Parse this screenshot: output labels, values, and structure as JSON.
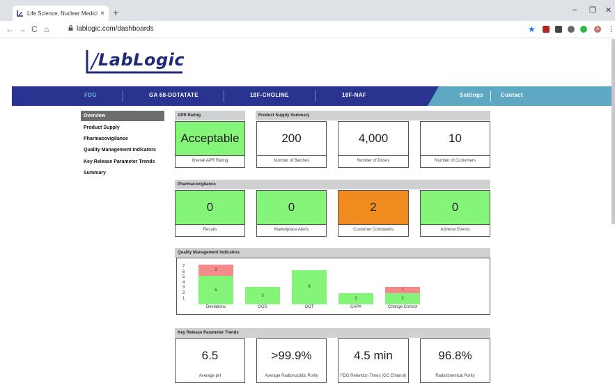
{
  "browser": {
    "tab_title": "Life Science, Nuclear Medicine &",
    "tab_close": "×",
    "new_tab": "+",
    "url": "lablogic.com/dashboards",
    "min": "–",
    "restore": "❐",
    "close": "✕",
    "back": "←",
    "forward": "→",
    "reload": "C",
    "home": "⌂",
    "profile_initial": "A",
    "menu": "⋮"
  },
  "logo": {
    "text": "LabLogic"
  },
  "nav": {
    "items": [
      "FDG",
      "GA 68-DOTATATE",
      "18F-CHOLINE",
      "18F-NAF"
    ],
    "settings": "Settings",
    "contact": "Contact",
    "colors": {
      "main": "#28348f",
      "right": "#5fa8c4"
    }
  },
  "sidebar": {
    "items": [
      "Overview",
      "Product Supply",
      "Pharmacovigilance",
      "Quality Management Indicators",
      "Key Release Parameter Trends",
      "Summary"
    ],
    "active": "Overview"
  },
  "apr": {
    "header": "APR Rating",
    "value": "Acceptable",
    "label": "Overall APR Rating"
  },
  "supply": {
    "header": "Product Supply Summary",
    "cards": [
      {
        "value": "200",
        "label": "Number of Batches"
      },
      {
        "value": "4,000",
        "label": "Number of Doses"
      },
      {
        "value": "10",
        "label": "Number of Customers"
      }
    ]
  },
  "pharma": {
    "header": "Pharmacovigilance",
    "cards": [
      {
        "value": "0",
        "label": "Recalls",
        "status": "green"
      },
      {
        "value": "0",
        "label": "Marketplace Alerts",
        "status": "green"
      },
      {
        "value": "2",
        "label": "Customer Complaints",
        "status": "orange"
      },
      {
        "value": "0",
        "label": "Adverse Events",
        "status": "green"
      }
    ]
  },
  "qmi": {
    "header": "Quality Management Indicators",
    "yticks": [
      "7",
      "6",
      "5",
      "4",
      "3",
      "2",
      "1"
    ],
    "bars": [
      {
        "label": "Deviations",
        "green": 5,
        "red": 2
      },
      {
        "label": "OOS",
        "green": 3,
        "red": 0
      },
      {
        "label": "OOT",
        "green": 6,
        "red": 0
      },
      {
        "label": "CAPA",
        "green": 2,
        "red": 0
      },
      {
        "label": "Change Control",
        "green": 2,
        "red": 1
      }
    ],
    "colors": {
      "green": "#85f57a",
      "red": "#f58a8a"
    }
  },
  "krp": {
    "header": "Key Release Parameter Trends",
    "cards": [
      {
        "value": "6.5",
        "label": "Average pH"
      },
      {
        "value": ">99.9%",
        "label": "Average Radionuclidic Purity"
      },
      {
        "value": "4.5 min",
        "label": "FDG Retention Times (GC Ethanol)"
      },
      {
        "value": "96.8%",
        "label": "Radiochemical Purity"
      }
    ]
  }
}
